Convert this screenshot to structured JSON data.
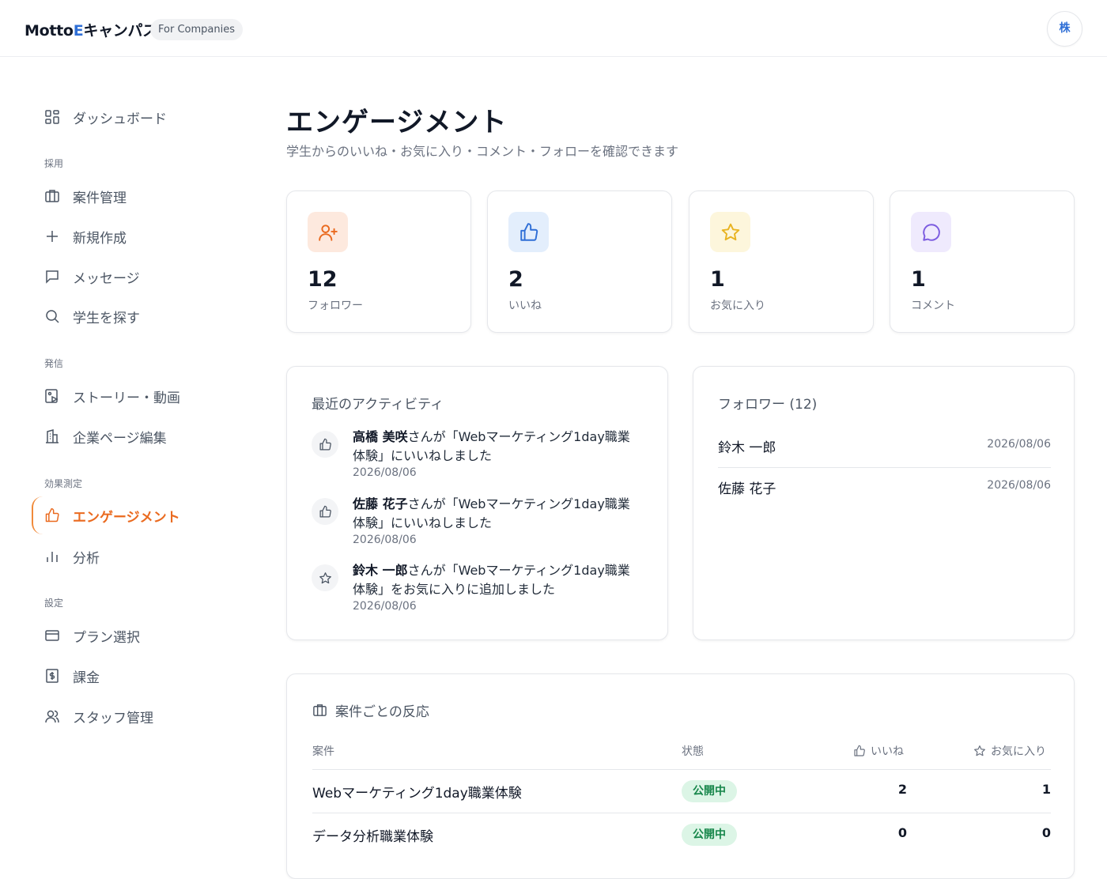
{
  "header": {
    "brand_prefix": "Motto",
    "brand_e": "E",
    "brand_suffix": "キャンパス",
    "badge": "For Companies",
    "avatar": "株"
  },
  "sidebar": {
    "dashboard": "ダッシュボード",
    "sections": {
      "recruit": "採用",
      "publish": "発信",
      "measure": "効果測定",
      "settings": "設定"
    },
    "items": {
      "jobs": "案件管理",
      "new": "新規作成",
      "messages": "メッセージ",
      "search": "学生を探す",
      "story": "ストーリー・動画",
      "company_page": "企業ページ編集",
      "engagement": "エンゲージメント",
      "analytics": "分析",
      "plan": "プラン選択",
      "billing": "課金",
      "staff": "スタッフ管理"
    }
  },
  "page": {
    "title": "エンゲージメント",
    "subtitle": "学生からのいいね・お気に入り・コメント・フォローを確認できます"
  },
  "stats": [
    {
      "value": "12",
      "label": "フォロワー",
      "icon": "user-plus-icon",
      "bg": "#fde9de",
      "color": "#ea6a1f"
    },
    {
      "value": "2",
      "label": "いいね",
      "icon": "thumbs-up-icon",
      "bg": "#e3eefc",
      "color": "#2f6fd6"
    },
    {
      "value": "1",
      "label": "お気に入り",
      "icon": "star-icon",
      "bg": "#fdf6dc",
      "color": "#e8b321"
    },
    {
      "value": "1",
      "label": "コメント",
      "icon": "message-circle-icon",
      "bg": "#efeafd",
      "color": "#7c5ce0"
    }
  ],
  "activity": {
    "title": "最近のアクティビティ",
    "items": [
      {
        "name": "高橋 美咲",
        "text_line1": "さんが「Webマーケティング1day職業",
        "text_line2": "体験」にいいねしました",
        "date": "2026/08/06",
        "icon": "thumbs-up-icon"
      },
      {
        "name": "佐藤 花子",
        "text_line1": "さんが「Webマーケティング1day職業",
        "text_line2": "体験」にいいねしました",
        "date": "2026/08/06",
        "icon": "thumbs-up-icon"
      },
      {
        "name": "鈴木 一郎",
        "text_line1": "さんが「Webマーケティング1day職業",
        "text_line2": "体験」をお気に入りに追加しました",
        "date": "2026/08/06",
        "icon": "star-icon"
      }
    ]
  },
  "followers": {
    "title": "フォロワー (12)",
    "items": [
      {
        "name": "鈴木 一郎",
        "date": "2026/08/06"
      },
      {
        "name": "佐藤 花子",
        "date": "2026/08/06"
      }
    ]
  },
  "jobs_table": {
    "title": "案件ごとの反応",
    "headers": {
      "job": "案件",
      "status": "状態",
      "likes": "いいね",
      "favorites": "お気に入り"
    },
    "rows": [
      {
        "job": "Webマーケティング1day職業体験",
        "status": "公開中",
        "likes": "2",
        "favorites": "1"
      },
      {
        "job": "データ分析職業体験",
        "status": "公開中",
        "likes": "0",
        "favorites": "0"
      }
    ]
  },
  "colors": {
    "accent": "#ea6a1f",
    "brand_blue": "#2f6fd6",
    "status_green": "#16864a"
  }
}
